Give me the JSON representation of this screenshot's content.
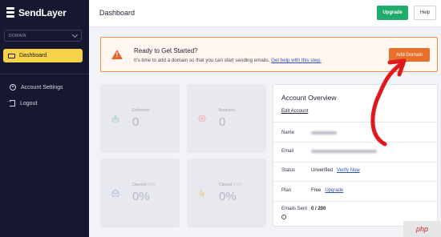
{
  "brand": {
    "name": "SendLayer"
  },
  "sidebar": {
    "domain_select": {
      "label": "DOMAIN"
    },
    "items": [
      {
        "label": "Dashboard",
        "icon": "dashboard-icon",
        "active": true
      },
      {
        "label": "Account Settings",
        "icon": "user-icon",
        "active": false
      },
      {
        "label": "Logout",
        "icon": "logout-icon",
        "active": false
      }
    ]
  },
  "header": {
    "title": "Dashboard",
    "upgrade_label": "Upgrade",
    "help_label": "Help"
  },
  "banner": {
    "title": "Ready to Get Started?",
    "text": "It's time to add a domain so that you can start sending emails.",
    "link": "Get help with this step.",
    "button_label": "Add Domain",
    "icon": "warning-icon"
  },
  "stats": [
    {
      "label": "Delivered",
      "extra": "",
      "value": "0",
      "icon": "inbox-icon"
    },
    {
      "label": "Bounced",
      "extra": "",
      "value": "0",
      "icon": "bounce-icon"
    },
    {
      "label": "Opened",
      "extra": "(0/0)",
      "value": "0%",
      "icon": "envelope-open-icon"
    },
    {
      "label": "Clicked",
      "extra": "(0/0)",
      "value": "0%",
      "icon": "cursor-icon"
    }
  ],
  "account_overview": {
    "title": "Account Overview",
    "edit_label": "Edit Account",
    "name_key": "Name",
    "email_key": "Email",
    "status_key": "Status",
    "status_value": "Unverified",
    "status_link": "Verify Now",
    "plan_key": "Plan",
    "plan_value": "Free",
    "plan_link": "Upgrade",
    "emails_sent_key": "Emails Sent",
    "emails_sent_value": "0 / 200"
  },
  "watermark": "php",
  "colors": {
    "sidebar_bg": "#15182f",
    "active_nav": "#f7d348",
    "upgrade_green": "#1fab6a",
    "banner_orange": "#e8702a",
    "annotation_red": "#e0191c",
    "link_blue": "#2e53c2"
  }
}
